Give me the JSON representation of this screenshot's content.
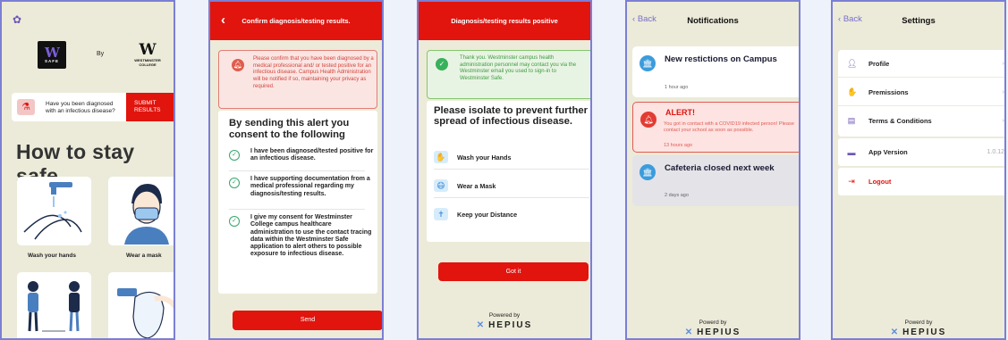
{
  "screen1": {
    "logo_safe_text": "SAFE",
    "by": "By",
    "college_text": "WESTMINSTER COLLEGE",
    "question_line1": "Have you been diagnosed",
    "question_line2": "with an infectious disease?",
    "submit_line1": "SUBMIT",
    "submit_line2": "RESULTS",
    "heading": "How to stay safe",
    "tiles": [
      "Wash your hands",
      "Wear a mask"
    ]
  },
  "screen2": {
    "title": "Confirm diagnosis/testing results.",
    "warning": "Please confirm that you have been diagnosed by a medical professional and/ or tested positive for an infectious disease. Campus Health Administration will be notified if so, maintaining your privacy as required.",
    "heading": "By sending this alert you consent to the following",
    "items": [
      "I have been diagnosed/tested positive for an infectious disease.",
      "I have supporting documentation from a medical professional regarding my diagnosis/testing results.",
      "I give my consent for Westminster College campus healthcare administration to use the contact tracing data within the Westminster Safe application to alert others to possible exposure to infectious disease."
    ],
    "send": "Send"
  },
  "screen3": {
    "title": "Diagnosis/testing results positive",
    "thanks": "Thank you. Westminster campus health administration personnel may contact you via the Westminster email you used to sign-in to Westminster Safe.",
    "heading": "Please isolate to prevent further spread of infectious disease.",
    "rows": [
      "Wash your Hands",
      "Wear a Mask",
      "Keep your Distance"
    ],
    "got_it": "Got it",
    "powered": "Powered by",
    "brand": "HEPIUS"
  },
  "screen4": {
    "back": "Back",
    "title": "Notifications",
    "notifications": [
      {
        "title": "New restictions on Campus",
        "body": "",
        "time": "1 hour ago"
      },
      {
        "title": "ALERT!",
        "body": "You got in contact with a COVID19 infected person! Please contact your school as soon as possible.",
        "time": "13 hours ago"
      },
      {
        "title": "Cafeteria closed next week",
        "body": "",
        "time": "2 days ago"
      }
    ],
    "powered": "Powerd by",
    "brand": "HEPIUS"
  },
  "screen5": {
    "back": "Back",
    "title": "Settings",
    "items": [
      "Profile",
      "Premissions",
      "Terms & Conditions"
    ],
    "version_label": "App Version",
    "version_value": "1.0.12",
    "logout": "Logout",
    "powered": "Powerd by",
    "brand": "HEPIUS"
  },
  "colors": {
    "brand_red": "#e1140e",
    "accent_purple": "#6d56b5",
    "background": "#ecebd9",
    "frame": "#7b7fd3"
  }
}
